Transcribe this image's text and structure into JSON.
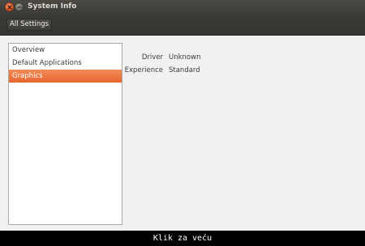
{
  "window": {
    "title": "System Info",
    "close_icon": "close-icon",
    "minimize_icon": "minimize-icon"
  },
  "toolbar": {
    "all_settings_label": "All Settings"
  },
  "sidebar": {
    "selected_index": 2,
    "items": [
      {
        "label": "Overview"
      },
      {
        "label": "Default Applications"
      },
      {
        "label": "Graphics"
      }
    ]
  },
  "details": [
    {
      "label": "Driver",
      "value": "Unknown"
    },
    {
      "label": "Experience",
      "value": "Standard"
    }
  ],
  "caption": {
    "text": "Klik za veću"
  },
  "colors": {
    "selection": "#e7672c",
    "titlebar": "#3c3b37",
    "window_background": "#f2f1f0",
    "close_button": "#df4a16"
  }
}
